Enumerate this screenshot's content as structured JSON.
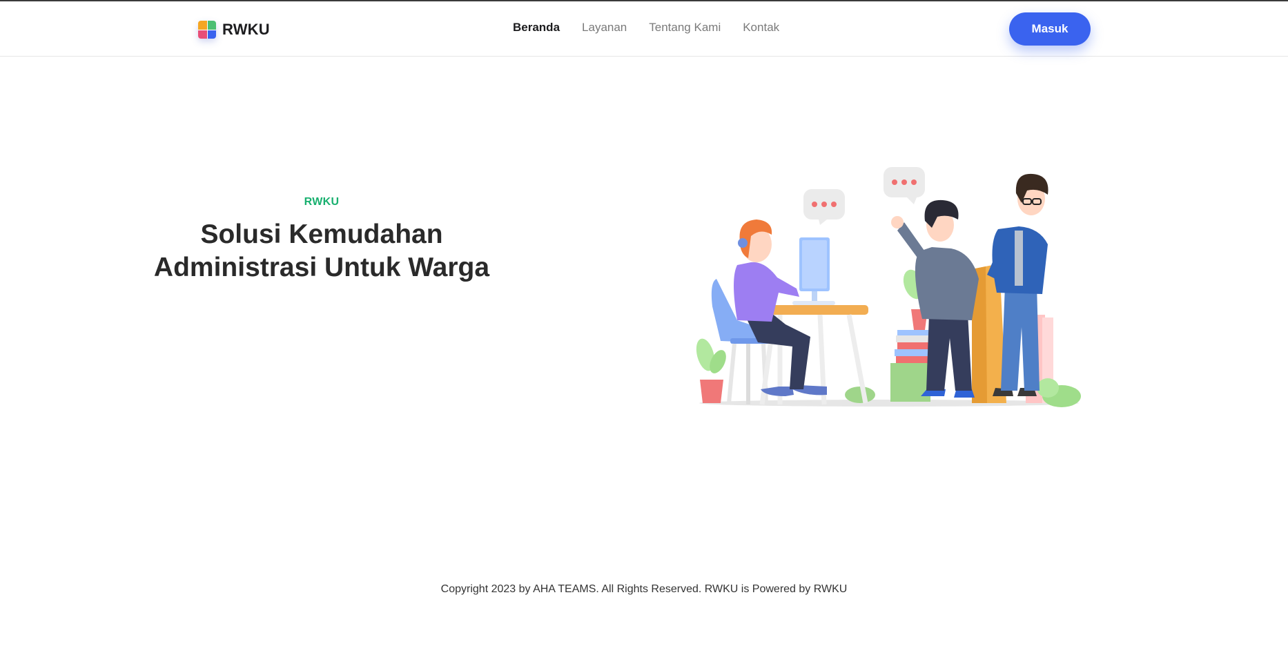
{
  "brand": {
    "name": "RWKU",
    "logo_icon": "rwku-logo-icon",
    "logo_colors": [
      "#f5a623",
      "#4bbf73",
      "#e94e77",
      "#3a63ef"
    ]
  },
  "nav": {
    "items": [
      {
        "label": "Beranda",
        "active": true
      },
      {
        "label": "Layanan",
        "active": false
      },
      {
        "label": "Tentang Kami",
        "active": false
      },
      {
        "label": "Kontak",
        "active": false
      }
    ],
    "login_label": "Masuk"
  },
  "hero": {
    "eyebrow": "RWKU",
    "title_line1": "Solusi Kemudahan",
    "title_line2": "Administrasi Untuk Warga",
    "illustration": "office-team-3d-illustration"
  },
  "footer": {
    "text": "Copyright 2023 by AHA TEAMS. All Rights Reserved. RWKU is Powered by RWKU"
  },
  "colors": {
    "accent": "#3a63ef",
    "eyebrow": "#18b06f",
    "title": "#2a2a2a"
  }
}
